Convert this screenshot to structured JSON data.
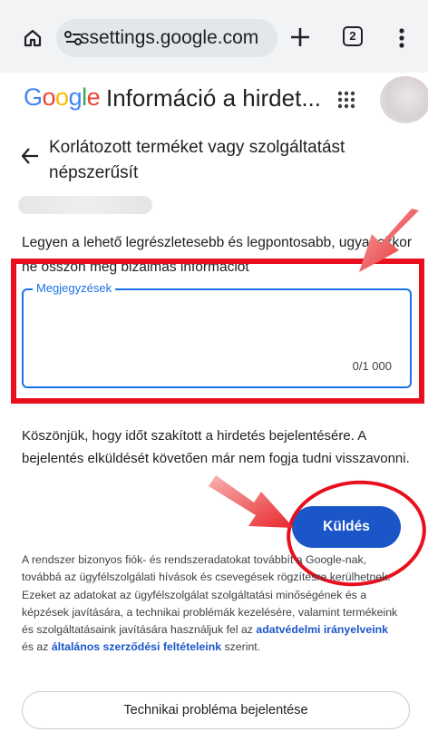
{
  "browser": {
    "url": "ssettings.google.com",
    "tab_count": "2"
  },
  "header": {
    "logo": [
      "G",
      "o",
      "o",
      "g",
      "l",
      "e"
    ],
    "title": "Információ a hirdet..."
  },
  "issue": {
    "title": "Korlátozott terméket vagy szolgáltatást népszerűsít"
  },
  "form": {
    "instruction": "Legyen a lehető legrészletesebb és legpontosabb, ugyanakkor ne osszon meg bizalmas információt",
    "notes_label": "Megjegyzések",
    "notes_value": "",
    "counter": "0/1 000",
    "thanks": "Köszönjük, hogy időt szakított a hirdetés bejelentésére. A bejelentés elküldését követően már nem fogja tudni visszavonni.",
    "send_label": "Küldés"
  },
  "disclaimer": {
    "text_1": "A rendszer bizonyos fiók- és rendszeradatokat továbbít a Google-nak, továbbá az ügyfélszolgálati hívások és csevegések rögzítésre kerülhetnek. Ezeket az adatokat az ügyfélszolgálat szolgáltatási minőségének és a képzések javítására, a technikai problémák kezelésére, valamint termékeink és szolgáltatásaink javítására használjuk fel az ",
    "link_privacy": "adatvédelmi irányelveink",
    "text_2": " és az ",
    "link_terms": "általános szerződési feltételeink",
    "text_3": " szerint."
  },
  "report_button": "Technikai probléma bejelentése",
  "annotation_color": "#e8101e",
  "accent_color": "#1a56c8"
}
